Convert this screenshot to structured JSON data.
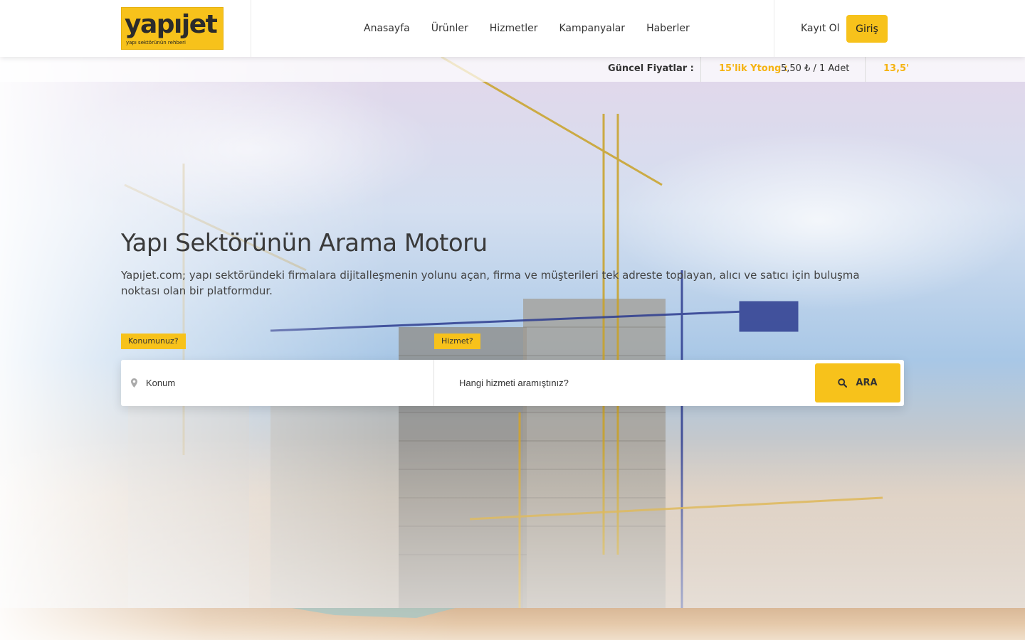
{
  "header": {
    "logo": {
      "word": "yapıjet",
      "tagline": "yapı sektörünün rehberi"
    },
    "nav": [
      "Anasayfa",
      "Ürünler",
      "Hizmetler",
      "Kampanyalar",
      "Haberler"
    ],
    "register_label": "Kayıt Ol",
    "login_label": "Giriş"
  },
  "ticker": {
    "title": "Güncel Fiyatlar :",
    "items": [
      {
        "name": "15'lik Ytong :",
        "value": "5,50 ₺ / 1 Adet"
      },
      {
        "name": "13,5'",
        "value": ""
      }
    ]
  },
  "hero": {
    "title": "Yapı Sektörünün Arama Motoru",
    "description": "Yapıjet.com; yapı sektöründeki firmalara dijitalleşmenin yolunu açan, firma ve müşterileri tek adreste toplayan, alıcı ve satıcı için buluşma noktası olan bir platformdur."
  },
  "search": {
    "location_tag": "Konumunuz?",
    "service_tag": "Hizmet?",
    "location_placeholder": "Konum",
    "service_placeholder": "Hangi hizmeti aramıştınız?",
    "button_label": "ARA"
  },
  "colors": {
    "accent": "#f7c21b",
    "text": "#333333",
    "ticker_name": "#f5b312"
  },
  "icons": {
    "location": "map-pin-icon",
    "search": "search-icon"
  }
}
